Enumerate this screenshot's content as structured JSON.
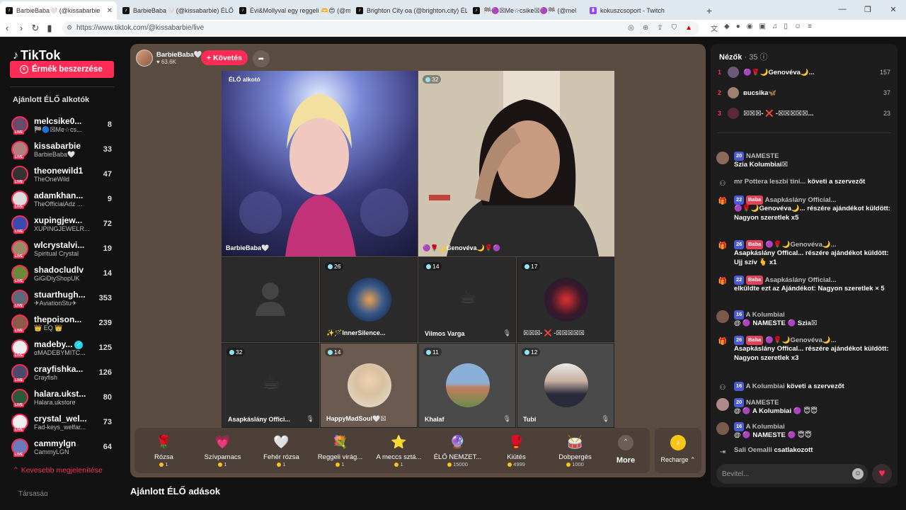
{
  "browser": {
    "tabs": [
      {
        "title": "BarbieBaba🤍 (@kissabarbie",
        "active": true
      },
      {
        "title": "BarbieBaba🤍 (@kissabarbie) ÉLŐ"
      },
      {
        "title": "Évi&Mollyval egy reggeli 🫶😍 (@m"
      },
      {
        "title": "Brighton City oa (@brighton.city) ÉLŐ"
      },
      {
        "title": "🏁🟣☒Me☆csike☒🟣🏁 (@mel"
      },
      {
        "title": "kokuszcsoport - Twitch"
      }
    ],
    "new_tab": "+",
    "url": "https://www.tiktok.com/@kissabarbie/live"
  },
  "sidebar": {
    "logo": "TikTok",
    "coins_button": "Érmék beszerzése",
    "section_title": "Ajánlott ÉLŐ alkotók",
    "creators": [
      {
        "name": "melcsike0...",
        "sub": "🏁🔵☒Me☆cs...",
        "count": "8"
      },
      {
        "name": "kissabarbie",
        "sub": "BarbieBaba🤍",
        "count": "33"
      },
      {
        "name": "theonewild1",
        "sub": "TheOneWild",
        "count": "47"
      },
      {
        "name": "adamkhan...",
        "sub": "TheOfficialAdz ...",
        "count": "9"
      },
      {
        "name": "xupingjew...",
        "sub": "XUPINGJEWELR...",
        "count": "72"
      },
      {
        "name": "wlcrystalvi...",
        "sub": "Spiritual Crystal",
        "count": "19"
      },
      {
        "name": "shadocludlv",
        "sub": "GiGiDiyShopUK",
        "count": "14"
      },
      {
        "name": "stuarthugh...",
        "sub": "✈AviationStu✈",
        "count": "353"
      },
      {
        "name": "thepoison...",
        "sub": "👑 EQ 👑",
        "count": "239"
      },
      {
        "name": "madeby...",
        "sub": "αMADEBYMITC...",
        "count": "125",
        "verified": true
      },
      {
        "name": "crayfishka...",
        "sub": "Crayfish",
        "count": "126"
      },
      {
        "name": "halara.ukst...",
        "sub": "Halara.ukstore",
        "count": "80"
      },
      {
        "name": "crystal_wel...",
        "sub": "Fad-keys_welfar...",
        "count": "73"
      },
      {
        "name": "cammylgn",
        "sub": "CammyLGN",
        "count": "64"
      }
    ],
    "show_less": "Kevesebb megjelenítése",
    "company": "Társaság"
  },
  "stream": {
    "host_name": "BarbieBaba🤍",
    "host_likes": "63.6K",
    "follow_label": "+ Követés",
    "creator_tag": "ÉLŐ alkotó",
    "tiles": {
      "host_label": "BarbieBaba🤍",
      "guest_badge": "32",
      "guest_label": "🟣🌹🌙Genovéva🌙🌹🟣",
      "t2": {
        "badge": "26",
        "label": "✨🪄InnerSilence..."
      },
      "t3": {
        "badge": "14",
        "label": "Vilmos Varga"
      },
      "t4": {
        "badge": "17",
        "label": "☒☒☒- ❌ -☒☒☒☒☒"
      },
      "t5": {
        "badge": "32",
        "label": "Asapkáslány Offici..."
      },
      "t6": {
        "badge": "14",
        "label": "HappyMadSoul🤍☒"
      },
      "t7": {
        "badge": "11",
        "label": "Khalaf"
      },
      "t8": {
        "badge": "12",
        "label": "Tubi"
      }
    },
    "gifts": [
      {
        "name": "Rózsa",
        "price": "1",
        "icon": "🌹"
      },
      {
        "name": "Szívpamacs",
        "price": "1",
        "icon": "💗"
      },
      {
        "name": "Fehér rózsa",
        "price": "1",
        "icon": "🤍"
      },
      {
        "name": "Reggeli virág...",
        "price": "1",
        "icon": "💐"
      },
      {
        "name": "A meccs sztá...",
        "price": "1",
        "icon": "⭐"
      },
      {
        "name": "ÉLŐ NEMZET...",
        "price": "15000",
        "icon": "🔮"
      },
      {
        "name": "Kiütés",
        "price": "4999",
        "icon": "🥊"
      },
      {
        "name": "Dobpergés",
        "price": "1000",
        "icon": "🥁"
      }
    ],
    "more_label": "More",
    "recharge_label": "Recharge ⌃",
    "bottom_title": "Ajánlott ÉLŐ adások"
  },
  "viewers": {
    "title": "Nézők",
    "count": "· 35",
    "top": [
      {
        "rank": "1",
        "name": "🟣🌹🌙Genovéva🌙...",
        "count": "157"
      },
      {
        "rank": "2",
        "name": "вucsika🦋",
        "count": "37"
      },
      {
        "rank": "3",
        "name": "☒☒☒- ❌ -☒☒☒☒☒...",
        "count": "23"
      }
    ]
  },
  "chat": {
    "messages": [
      {
        "level": "20",
        "name": "NAMESTE",
        "text": "Szia Kolumbiai☒"
      },
      {
        "name": "mr Pottera leszbi tini...",
        "text": "követi a szervezőt"
      },
      {
        "level": "22",
        "badge": "Baba",
        "name": "Asapkáslány Official...",
        "text": "🟣🌹🌙Genovéva🌙... részére ajándékot küldött: Nagyon szeretlek x5"
      },
      {
        "level": "26",
        "badge": "Baba",
        "name": "🟣🌹🌙Genovéva🌙...",
        "text": "Asapkáslány Offical... részére ajándékot küldött: Ujj szív 🫰 x1"
      },
      {
        "level": "22",
        "badge": "Baba",
        "name": "Asapkáslány Official...",
        "text": "elküldte ezt az Ajándékot: Nagyon szeretlek × 5"
      },
      {
        "level": "16",
        "name": "A Kolumbiai",
        "text": "@ 🟣 NAMESTE 🟣 Szia☒"
      },
      {
        "level": "26",
        "badge": "Baba",
        "name": "🟣🌹🌙Genovéva🌙...",
        "text": "Asapkáslány Offical... részére ajándékot küldött: Nagyon szeretlek x3"
      },
      {
        "level": "16",
        "name": "A Kolumbiai",
        "text": "követi a szervezőt"
      },
      {
        "level": "20",
        "name": "NAMESTE",
        "text": "@ 🟣 A Kolumbiai 🟣 😇😇"
      },
      {
        "level": "16",
        "name": "A Kolumbiai",
        "text": "@ 🟣 NAMESTE 🟣 😇😇"
      },
      {
        "name": "Sali Oemalli",
        "text": "csatlakozott"
      }
    ],
    "input_placeholder": "Bevitel..."
  }
}
